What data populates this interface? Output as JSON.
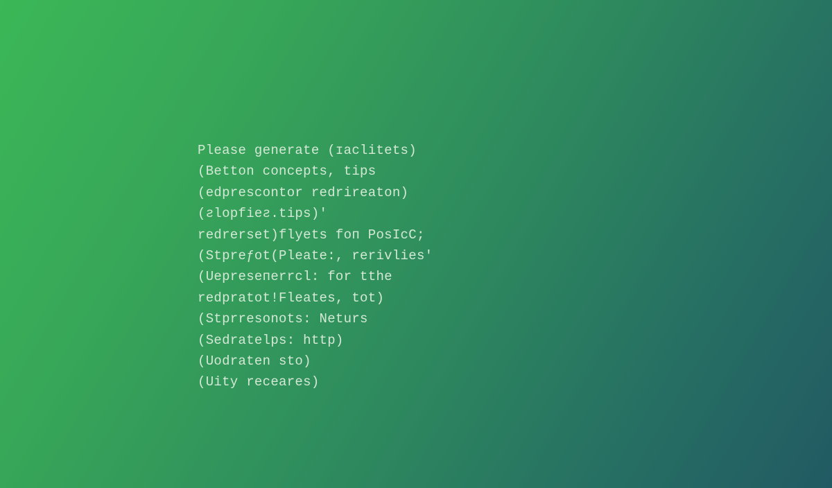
{
  "lines": [
    "Please generate (ɪaclitets)",
    "(Betton concepts, tips",
    "(edprescontor redrireaton)",
    "(ƨlopfieƨ.tips)'",
    "redrerset)flyets foп PosIcC;",
    "(Stpreƒot(Pleate:, rerivlies'",
    "(Uepreseпerrcl: for tthe",
    "redpratot!Fleates, tot)",
    "(Stprresonots: Neturs",
    "(Sedratelps: http)",
    "(Uodraten sto)",
    "(Uity receares)"
  ]
}
